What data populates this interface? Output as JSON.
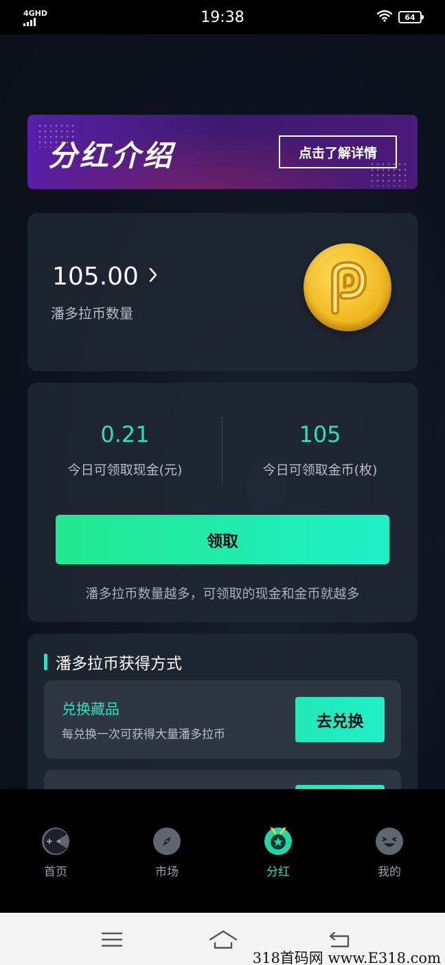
{
  "status_bar": {
    "network": "4GHD",
    "time": "19:38",
    "battery": "64"
  },
  "banner": {
    "title": "分红介绍",
    "button_label": "点击了解详情"
  },
  "coin_card": {
    "balance": "105.00",
    "label": "潘多拉币数量"
  },
  "claim_card": {
    "cash_value": "0.21",
    "cash_label": "今日可领取现金(元)",
    "gold_value": "105",
    "gold_label": "今日可领取金币(枚)",
    "claim_button": "领取",
    "note": "潘多拉币数量越多，可领取的现金和金币就越多"
  },
  "ways_card": {
    "title": "潘多拉币获得方式",
    "items": [
      {
        "name": "兑换藏品",
        "desc": "每兑换一次可获得大量潘多拉币",
        "button": "去兑换"
      }
    ]
  },
  "tabbar": {
    "items": [
      {
        "label": "首页",
        "icon": "gamepad-icon"
      },
      {
        "label": "市场",
        "icon": "compass-icon"
      },
      {
        "label": "分红",
        "icon": "medal-star-icon"
      },
      {
        "label": "我的",
        "icon": "smiley-icon"
      }
    ],
    "active_index": 2
  },
  "watermark": "318首码网  www.E318.com",
  "colors": {
    "accent": "#2de0c0",
    "claim_gradient_start": "#22e88f",
    "claim_gradient_end": "#1ff0c8",
    "banner_purple": "#5a1fa8"
  }
}
